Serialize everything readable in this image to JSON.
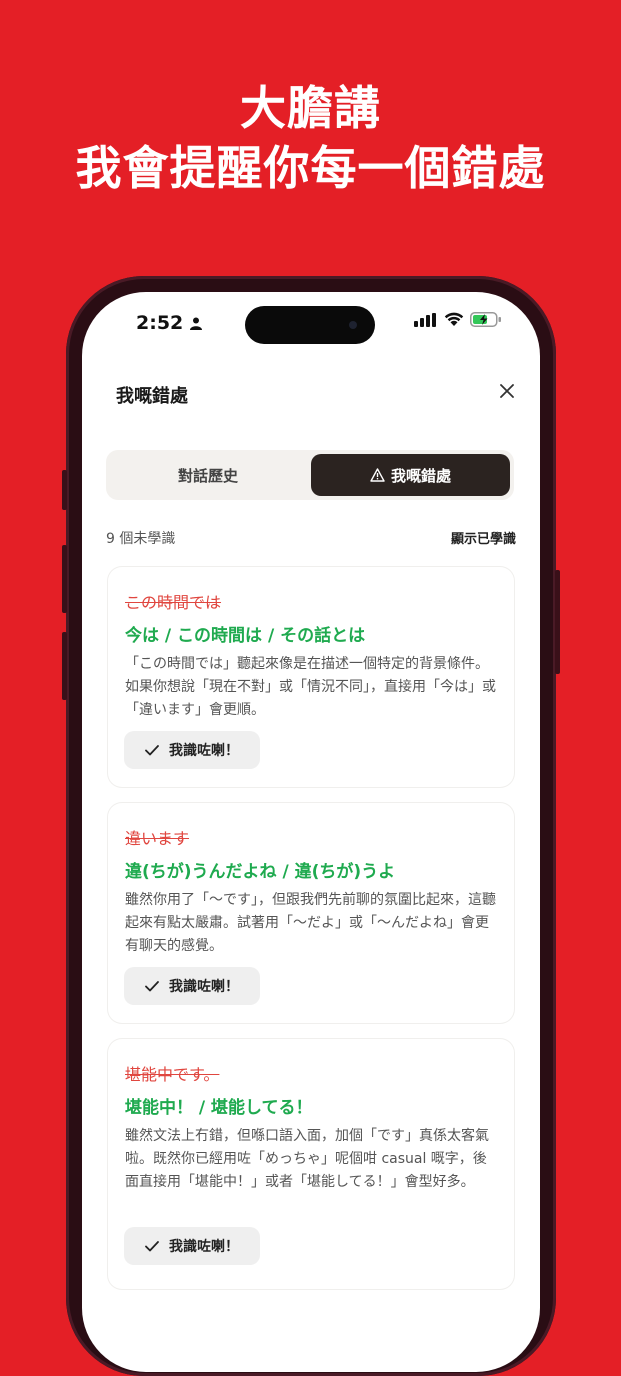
{
  "headline": {
    "line1": "大膽講",
    "line2": "我會提醒你每一個錯處"
  },
  "status": {
    "time": "2:52"
  },
  "page": {
    "title": "我嘅錯處"
  },
  "tabs": {
    "history": "對話歷史",
    "mistakes": "我嘅錯處"
  },
  "list": {
    "count": "9 個未學識",
    "show_learned": "顯示已學識"
  },
  "cards": [
    {
      "wrong": "この時間では",
      "correct": "今は / この時間は / その話とは",
      "explanation": "「この時間では」聽起來像是在描述一個特定的背景條件。如果你想說「現在不對」或「情況不同」，直接用「今は」或「違います」會更順。",
      "button": "我識咗喇！"
    },
    {
      "wrong": "違います",
      "correct": "違(ちが)うんだよね / 違(ちが)うよ",
      "explanation": "雖然你用了「〜です」，但跟我們先前聊的氛圍比起來，這聽起來有點太嚴肅。試著用「〜だよ」或「〜んだよね」會更有聊天的感覺。",
      "button": "我識咗喇！"
    },
    {
      "wrong": "堪能中です。",
      "correct": "堪能中！ / 堪能してる！",
      "explanation": "雖然文法上冇錯，但喺口語入面，加個「です」真係太客氣啦。既然你已經用咗「めっちゃ」呢個咁 casual 嘅字，後面直接用「堪能中！」或者「堪能してる！」會型好多。",
      "button": "我識咗喇！"
    }
  ],
  "colors": {
    "background": "#e41f26",
    "wrong": "#e0463f",
    "correct": "#1faa4f",
    "active_tab": "#2b2320"
  }
}
